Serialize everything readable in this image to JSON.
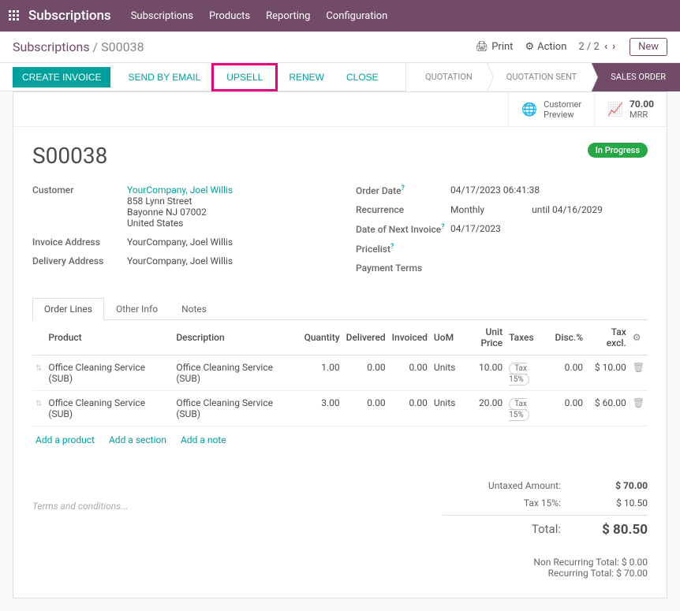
{
  "nav": {
    "app": "Subscriptions",
    "menu": [
      "Subscriptions",
      "Products",
      "Reporting",
      "Configuration"
    ]
  },
  "breadcrumb": {
    "root": "Subscriptions",
    "sep": " / ",
    "current": "S00038"
  },
  "cp": {
    "print": "Print",
    "action": "Action",
    "pager": "2 / 2",
    "new": "New"
  },
  "actions": {
    "create_invoice": "CREATE INVOICE",
    "send_by_email": "SEND BY EMAIL",
    "upsell": "UPSELL",
    "renew": "RENEW",
    "close": "CLOSE"
  },
  "status": {
    "quotation": "QUOTATION",
    "quotation_sent": "QUOTATION SENT",
    "sales_order": "SALES ORDER"
  },
  "stats": {
    "customer_preview_l1": "Customer",
    "customer_preview_l2": "Preview",
    "mrr_val": "70.00",
    "mrr_lbl": "MRR"
  },
  "record": {
    "name": "S00038",
    "badge": "In Progress",
    "left": {
      "customer_lbl": "Customer",
      "customer_name": "YourCompany, Joel Willis",
      "addr1": "858 Lynn Street",
      "addr2": "Bayonne NJ 07002",
      "addr3": "United States",
      "invoice_addr_lbl": "Invoice Address",
      "invoice_addr": "YourCompany, Joel Willis",
      "delivery_addr_lbl": "Delivery Address",
      "delivery_addr": "YourCompany, Joel Willis"
    },
    "right": {
      "order_date_lbl": "Order Date",
      "order_date": "04/17/2023 06:41:38",
      "recurrence_lbl": "Recurrence",
      "recurrence": "Monthly",
      "recurrence_until": "until 04/16/2029",
      "next_inv_lbl": "Date of Next Invoice",
      "next_inv": "04/17/2023",
      "pricelist_lbl": "Pricelist",
      "payment_terms_lbl": "Payment Terms"
    }
  },
  "tabs": {
    "order_lines": "Order Lines",
    "other_info": "Other Info",
    "notes": "Notes"
  },
  "table": {
    "headers": {
      "product": "Product",
      "description": "Description",
      "qty": "Quantity",
      "delivered": "Delivered",
      "invoiced": "Invoiced",
      "uom": "UoM",
      "unit_price": "Unit Price",
      "taxes": "Taxes",
      "disc": "Disc.%",
      "tax_excl": "Tax excl."
    },
    "rows": [
      {
        "product": "Office Cleaning Service (SUB)",
        "desc": "Office Cleaning Service (SUB)",
        "qty": "1.00",
        "delivered": "0.00",
        "invoiced": "0.00",
        "uom": "Units",
        "unit_price": "10.00",
        "tax": "Tax 15%",
        "disc": "0.00",
        "tax_excl": "$ 10.00"
      },
      {
        "product": "Office Cleaning Service (SUB)",
        "desc": "Office Cleaning Service (SUB)",
        "qty": "3.00",
        "delivered": "0.00",
        "invoiced": "0.00",
        "uom": "Units",
        "unit_price": "20.00",
        "tax": "Tax 15%",
        "disc": "0.00",
        "tax_excl": "$ 60.00"
      }
    ],
    "add_product": "Add a product",
    "add_section": "Add a section",
    "add_note": "Add a note"
  },
  "terms_placeholder": "Terms and conditions...",
  "totals": {
    "untaxed_lbl": "Untaxed Amount:",
    "untaxed": "$ 70.00",
    "tax_lbl": "Tax 15%:",
    "tax": "$ 10.50",
    "total_lbl": "Total:",
    "total": "$ 80.50",
    "nonrec": "Non Recurring Total: $ 0.00",
    "rec": "Recurring Total: $ 70.00"
  }
}
